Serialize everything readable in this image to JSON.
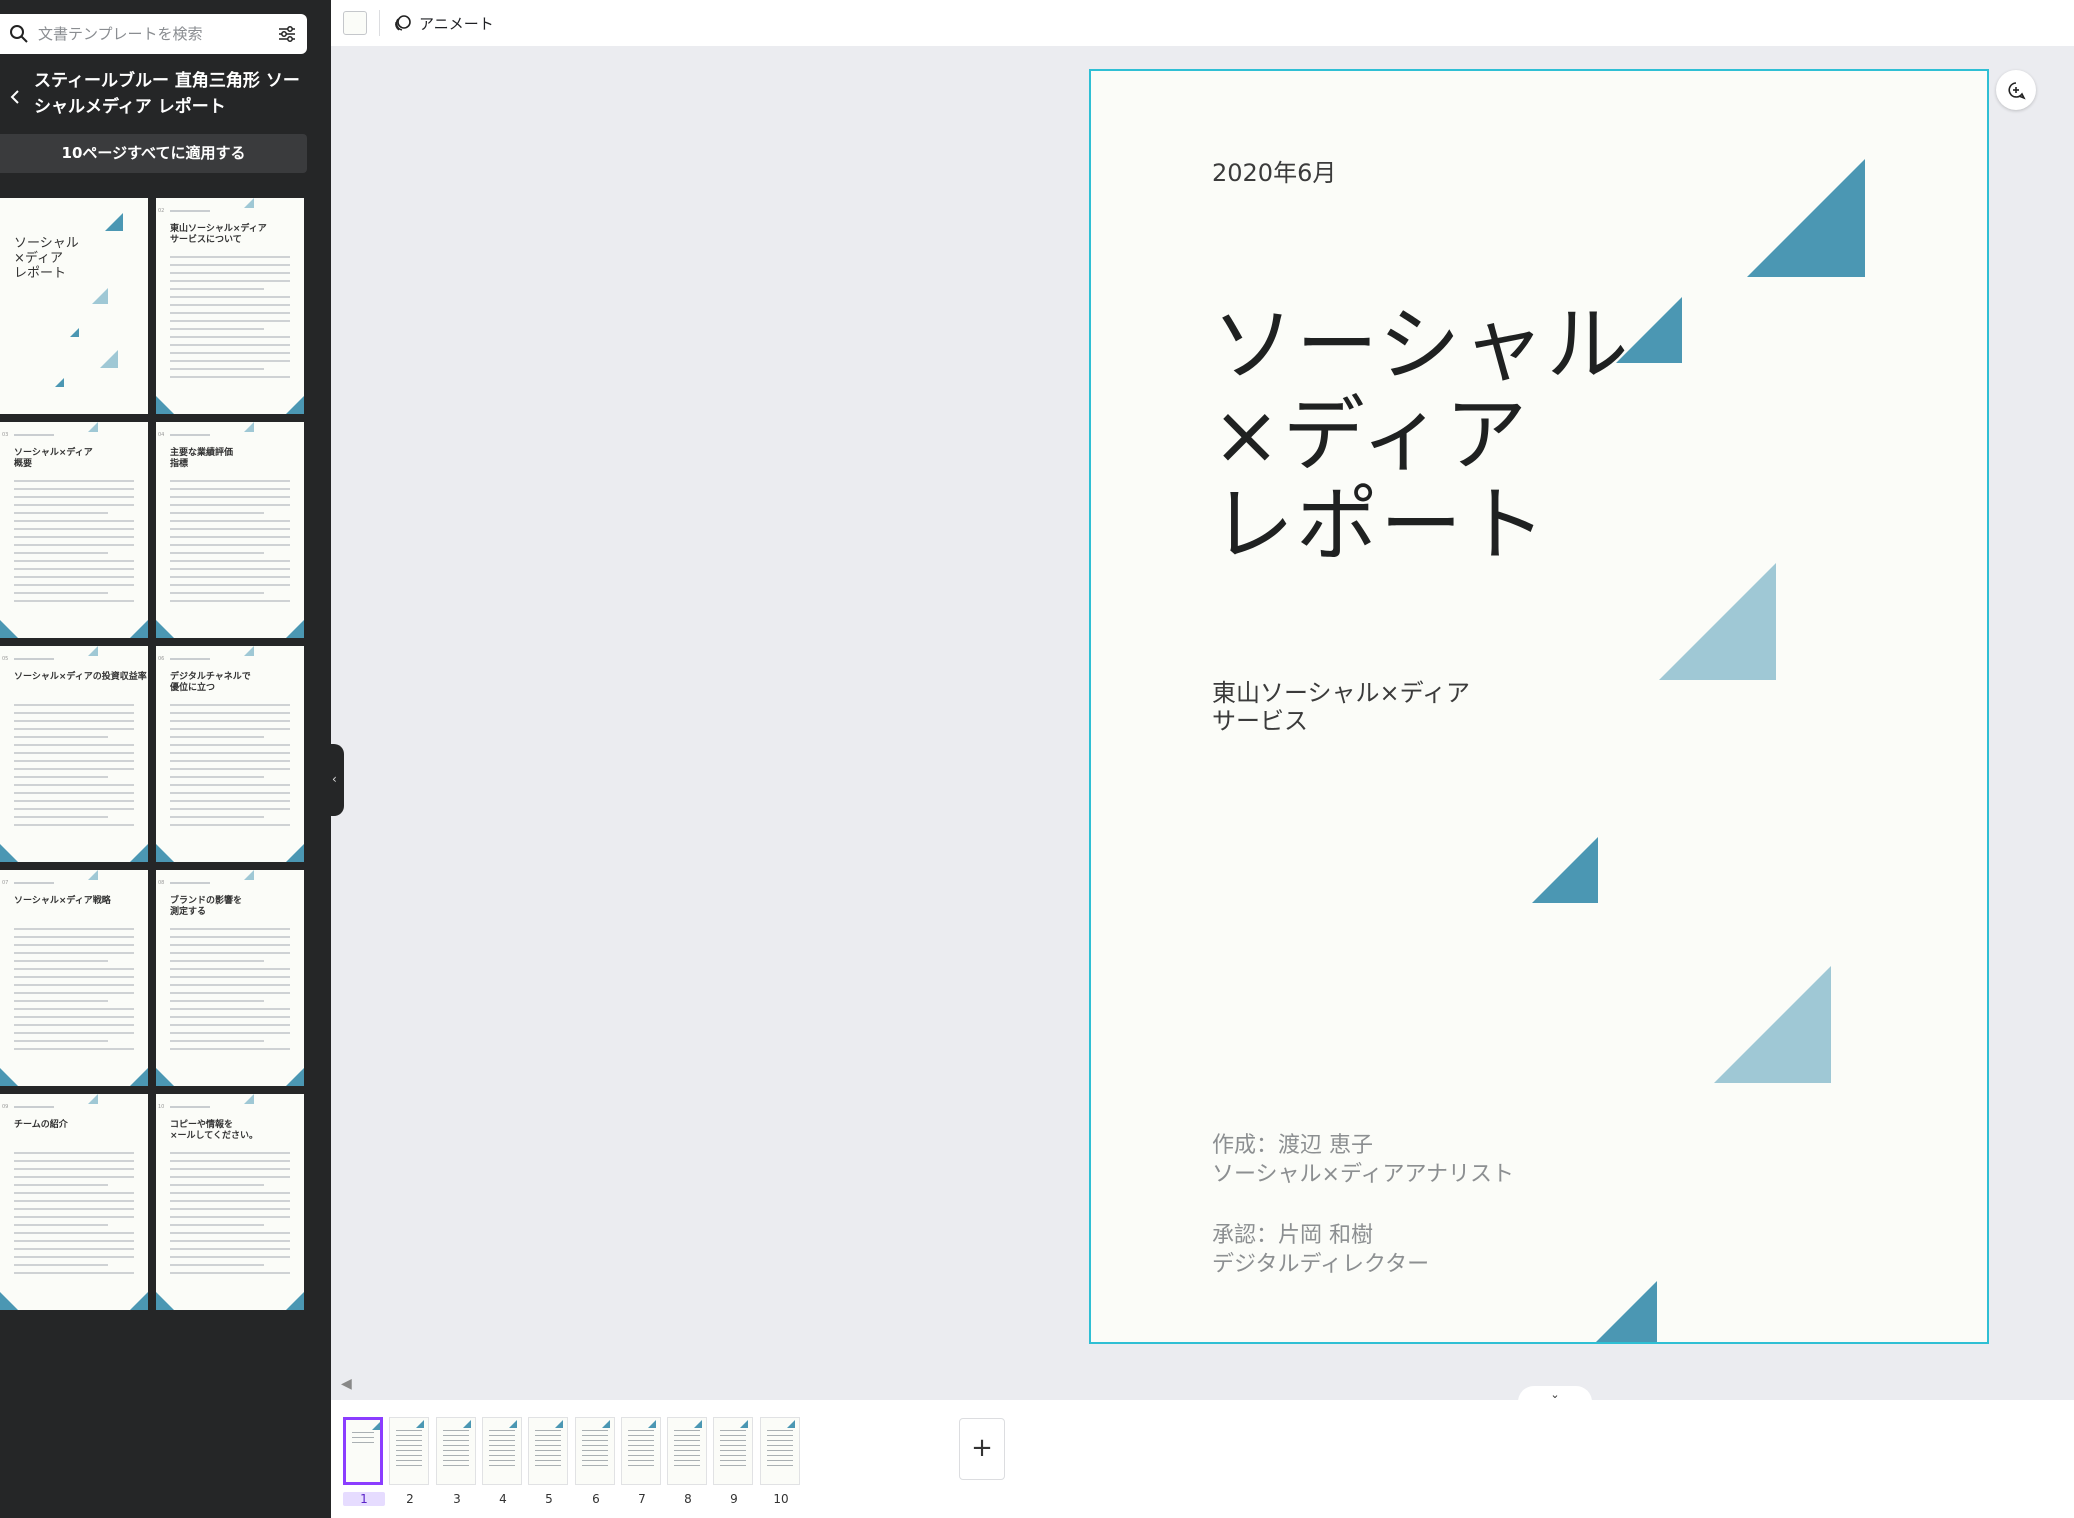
{
  "search": {
    "placeholder": "文書テンプレートを検索"
  },
  "template": {
    "title": "スティールブルー 直角三角形 ソーシャルメディア レポート",
    "apply_all_label": "10ページすべてに適用する"
  },
  "toolbar": {
    "animate_label": "アニメート"
  },
  "page": {
    "date": "2020年6月",
    "title_lines": [
      "ソーシャル",
      "×ディア",
      "レポート"
    ],
    "subtitle_lines": [
      "東山ソーシャル×ディア",
      "サービス"
    ],
    "author_lines": [
      "作成：渡辺 恵子",
      "ソーシャル×ディアアナリスト"
    ],
    "approver_lines": [
      "承認：片岡 和樹",
      "デジタルディレクター"
    ]
  },
  "sidebar_pages": [
    {
      "num": "",
      "heading": "ソーシャル\n×ディア\nレポート"
    },
    {
      "num": "02",
      "heading": "東山ソーシャル×ディア\nサービスについて"
    },
    {
      "num": "03",
      "heading": "ソーシャル×ディア\n概要"
    },
    {
      "num": "04",
      "heading": "主要な業績評価\n指標"
    },
    {
      "num": "05",
      "heading": "ソーシャル×ディアの投資収益率"
    },
    {
      "num": "06",
      "heading": "デジタルチャネルで\n優位に立つ"
    },
    {
      "num": "07",
      "heading": "ソーシャル×ディア戦略"
    },
    {
      "num": "08",
      "heading": "ブランドの影響を\n測定する"
    },
    {
      "num": "09",
      "heading": "チームの紹介"
    },
    {
      "num": "10",
      "heading": "コピーや情報を\n×ールしてください。"
    }
  ],
  "page_strip": {
    "pages": [
      "1",
      "2",
      "3",
      "4",
      "5",
      "6",
      "7",
      "8",
      "9",
      "10"
    ],
    "active": 1,
    "add_label": "+"
  },
  "colors": {
    "accent_dark": "#4b97b3",
    "accent_light": "#9fc8d5",
    "selection": "#2fbfd4",
    "active_page": "#8b3dff"
  },
  "icons": [
    "search-icon",
    "filter-icon",
    "chevron-left-icon",
    "animate-icon",
    "add-comment-icon",
    "chevron-down-icon"
  ]
}
